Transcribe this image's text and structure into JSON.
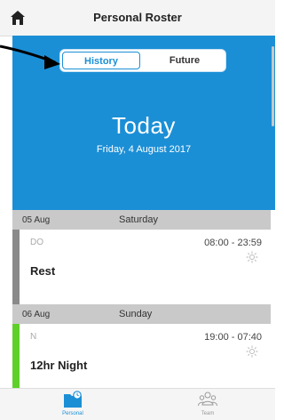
{
  "header": {
    "title": "Personal Roster",
    "home_icon": "home-icon"
  },
  "segmented": {
    "history_label": "History",
    "future_label": "Future",
    "selected": "History"
  },
  "banner": {
    "today_label": "Today",
    "date_label": "Friday, 4 August 2017",
    "color": "#1b8fd6"
  },
  "days": [
    {
      "date": "05 Aug",
      "weekday": "Saturday",
      "shift": {
        "code": "DO",
        "time": "08:00 - 23:59",
        "name": "Rest",
        "icon": "sun-icon",
        "color": "#8a8a8a"
      }
    },
    {
      "date": "06 Aug",
      "weekday": "Sunday",
      "shift": {
        "code": "N",
        "time": "19:00 - 07:40",
        "name": "12hr Night",
        "icon": "sun-icon",
        "color": "#5fd02a"
      }
    }
  ],
  "tabs": {
    "personal_label": "Personal",
    "team_label": "Team",
    "active": "Personal"
  }
}
